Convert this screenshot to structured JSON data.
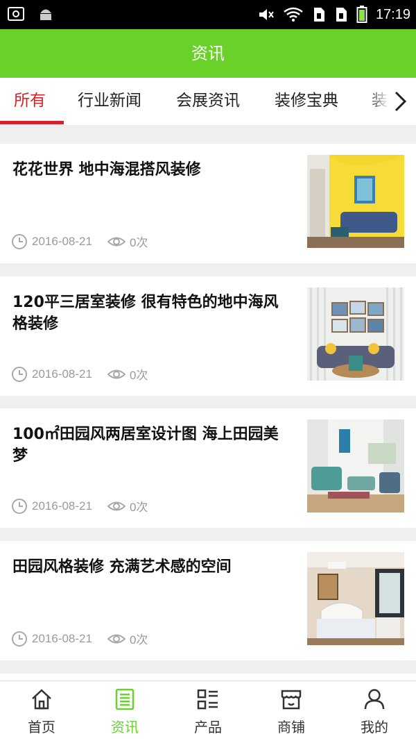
{
  "status_bar": {
    "time": "17:19",
    "icons": [
      "screenshot-icon",
      "android-icon",
      "mute-icon",
      "wifi-icon",
      "sim1-icon",
      "sim2-icon",
      "battery-icon"
    ]
  },
  "header": {
    "title": "资讯"
  },
  "tabs": [
    {
      "label": "所有",
      "active": true
    },
    {
      "label": "行业新闻",
      "active": false
    },
    {
      "label": "会展资讯",
      "active": false
    },
    {
      "label": "装修宝典",
      "active": false
    },
    {
      "label": "装修",
      "active": false
    }
  ],
  "news": [
    {
      "title": "花花世界 地中海混搭风装修",
      "date": "2016-08-21",
      "views": "0次"
    },
    {
      "title": "120平三居室装修 很有特色的地中海风格装修",
      "date": "2016-08-21",
      "views": "0次"
    },
    {
      "title": "100㎡田园风两居室设计图 海上田园美梦",
      "date": "2016-08-21",
      "views": "0次"
    },
    {
      "title": "田园风格装修 充满艺术感的空间",
      "date": "2016-08-21",
      "views": "0次"
    }
  ],
  "bottom_nav": [
    {
      "label": "首页",
      "icon": "home-icon",
      "active": false
    },
    {
      "label": "资讯",
      "icon": "news-icon",
      "active": true
    },
    {
      "label": "产品",
      "icon": "products-icon",
      "active": false
    },
    {
      "label": "商铺",
      "icon": "shop-icon",
      "active": false
    },
    {
      "label": "我的",
      "icon": "profile-icon",
      "active": false
    }
  ],
  "colors": {
    "accent_green": "#6ad12a",
    "active_red": "#d2232a",
    "meta_gray": "#9a9a9a"
  }
}
